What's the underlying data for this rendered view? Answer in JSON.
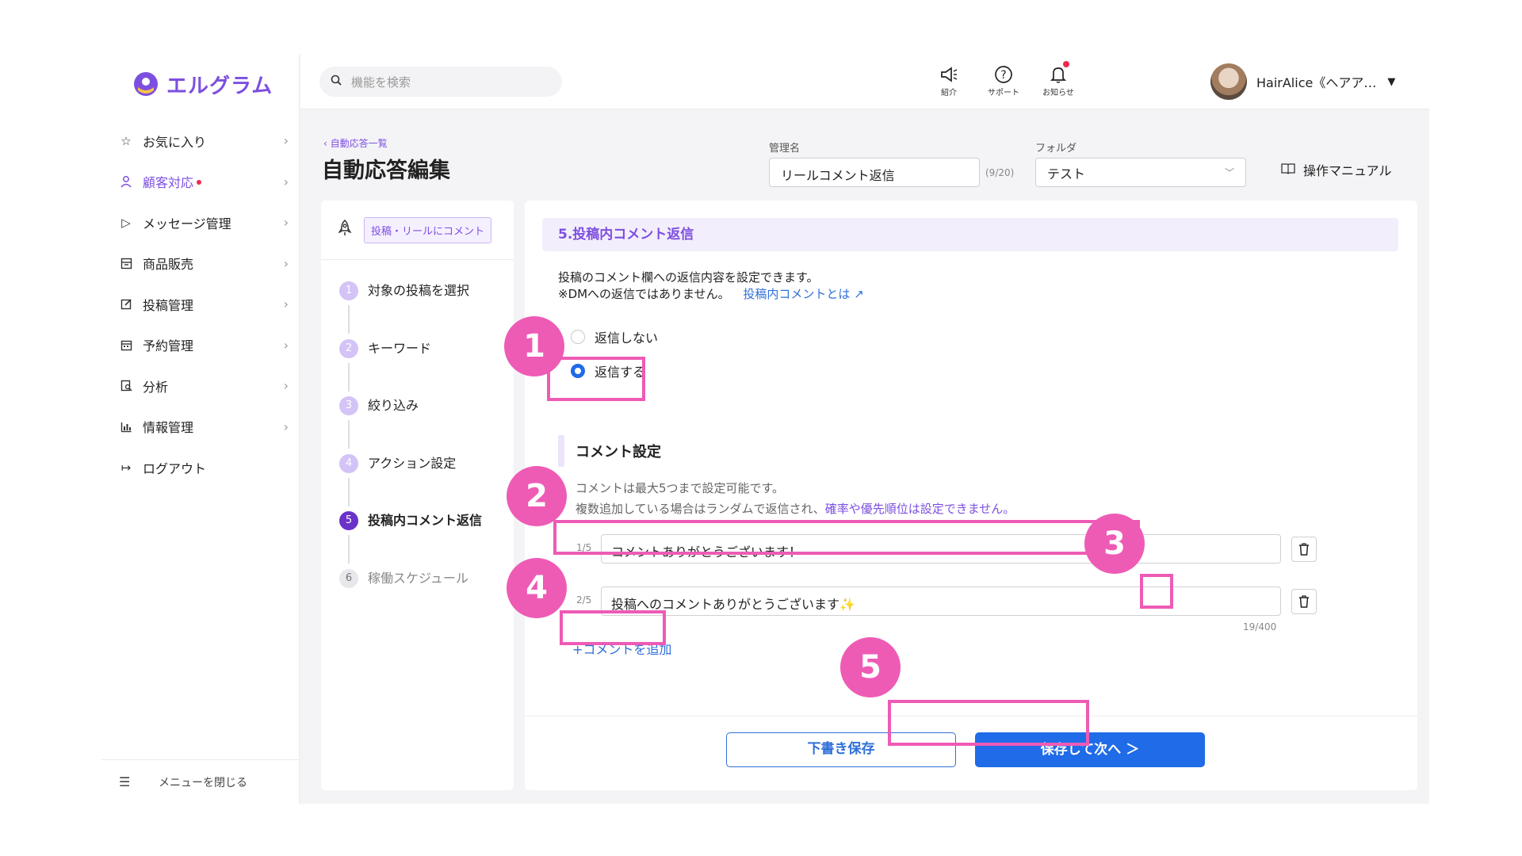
{
  "app": {
    "name": "エルグラム"
  },
  "sidebar": {
    "items": [
      {
        "label": "お気に入り",
        "icon": "star-icon",
        "active": false,
        "dot": false
      },
      {
        "label": "顧客対応",
        "icon": "person-icon",
        "active": true,
        "dot": true
      },
      {
        "label": "メッセージ管理",
        "icon": "send-icon",
        "active": false,
        "dot": false
      },
      {
        "label": "商品販売",
        "icon": "store-icon",
        "active": false,
        "dot": false
      },
      {
        "label": "投稿管理",
        "icon": "edit-icon",
        "active": false,
        "dot": false
      },
      {
        "label": "予約管理",
        "icon": "calendar-icon",
        "active": false,
        "dot": false
      },
      {
        "label": "分析",
        "icon": "analytics-icon",
        "active": false,
        "dot": false
      },
      {
        "label": "情報管理",
        "icon": "chart-icon",
        "active": false,
        "dot": false
      }
    ],
    "logout_label": "ログアウト",
    "close_menu_label": "メニューを閉じる"
  },
  "header": {
    "search_placeholder": "機能を検索",
    "intro_label": "紹介",
    "support_label": "サポート",
    "notifications_label": "お知らせ",
    "user_name": "HairAlice《ヘアア…"
  },
  "page": {
    "breadcrumb": "自動応答一覧",
    "title": "自動応答編集",
    "manage_name_label": "管理名",
    "manage_name_value": "リールコメント返信",
    "manage_name_counter": "(9/20)",
    "folder_label": "フォルダ",
    "folder_value": "テスト",
    "manual_label": "操作マニュアル"
  },
  "steps": {
    "trigger_tag": "投稿・リールにコメント",
    "items": [
      {
        "num": "1",
        "label": "対象の投稿を選択"
      },
      {
        "num": "2",
        "label": "キーワード"
      },
      {
        "num": "3",
        "label": "絞り込み"
      },
      {
        "num": "4",
        "label": "アクション設定"
      },
      {
        "num": "5",
        "label": "投稿内コメント返信"
      },
      {
        "num": "6",
        "label": "稼働スケジュール"
      }
    ]
  },
  "main": {
    "section_title": "5.投稿内コメント返信",
    "desc_line1": "投稿のコメント欄への返信内容を設定できます。",
    "desc_line2": "※DMへの返信ではありません。",
    "desc_link": "投稿内コメントとは",
    "radio_no_reply": "返信しない",
    "radio_reply": "返信する",
    "comment_settings_title": "コメント設定",
    "note_line1": "コメントは最大5つまで設定可能です。",
    "note_line2_a": "複数追加している場合はランダムで返信され、",
    "note_line2_b": "確率や優先順位は設定できません。",
    "comments": [
      {
        "index": "1/5",
        "text": "コメントありがとうございます！"
      },
      {
        "index": "2/5",
        "text": "投稿へのコメントありがとうございます✨"
      }
    ],
    "char_count": "19/400",
    "add_comment_label": "+コメントを追加",
    "draft_button": "下書き保存",
    "next_button": "保存して次へ ＞"
  },
  "annotations": [
    "1",
    "2",
    "3",
    "4",
    "5"
  ],
  "colors": {
    "brand": "#7d4fe0",
    "primary": "#1f6be8",
    "highlight": "#ee5bb5"
  }
}
